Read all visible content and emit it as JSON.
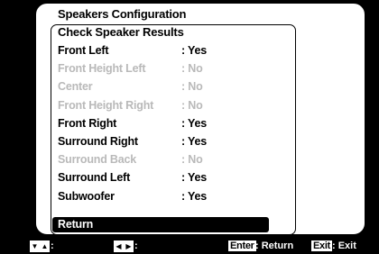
{
  "menu": {
    "title": "Speakers Configuration",
    "subtitle": "Check Speaker Results"
  },
  "speakers": [
    {
      "label": "Front Left",
      "value": ": Yes",
      "active": true
    },
    {
      "label": "Front Height Left",
      "value": ": No",
      "active": false
    },
    {
      "label": "Center",
      "value": ": No",
      "active": false
    },
    {
      "label": "Front Height Right",
      "value": ": No",
      "active": false
    },
    {
      "label": "Front Right",
      "value": ": Yes",
      "active": true
    },
    {
      "label": "Surround Right",
      "value": ": Yes",
      "active": true
    },
    {
      "label": "Surround Back",
      "value": ": No",
      "active": false
    },
    {
      "label": "Surround Left",
      "value": ": Yes",
      "active": true
    },
    {
      "label": "Subwoofer",
      "value": ": Yes",
      "active": true
    }
  ],
  "return_label": "Return",
  "footer": {
    "updown_icon": "up-down-arrows-icon",
    "updown_sep": ":",
    "leftright_icon": "left-right-arrows-icon",
    "leftright_sep": ":",
    "enter_key": "Enter",
    "enter_action": ": Return",
    "exit_key": "Exit",
    "exit_action": ": Exit"
  }
}
